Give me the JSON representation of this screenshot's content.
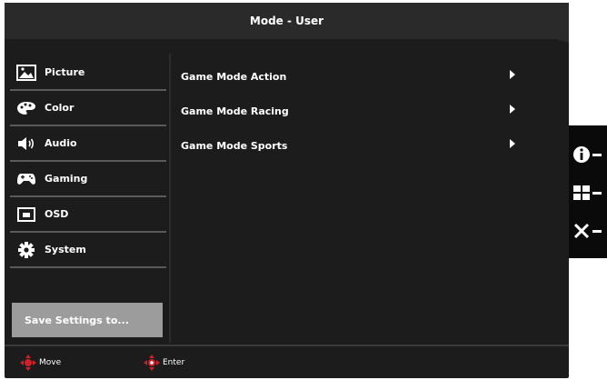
{
  "title": "Mode - User",
  "sidebar": {
    "items": [
      {
        "label": "Picture",
        "icon": "picture-icon"
      },
      {
        "label": "Color",
        "icon": "palette-icon"
      },
      {
        "label": "Audio",
        "icon": "speaker-icon"
      },
      {
        "label": "Gaming",
        "icon": "gamepad-icon"
      },
      {
        "label": "OSD",
        "icon": "osd-window-icon"
      },
      {
        "label": "System",
        "icon": "gear-icon"
      }
    ],
    "save_label": "Save Settings to..."
  },
  "options": [
    {
      "label": "Game Mode Action"
    },
    {
      "label": "Game Mode Racing"
    },
    {
      "label": "Game Mode Sports"
    }
  ],
  "footer": {
    "move_label": "Move",
    "enter_label": "Enter"
  },
  "hotkeys": [
    {
      "icon": "info-icon"
    },
    {
      "icon": "menu-grid-icon"
    },
    {
      "icon": "close-icon"
    }
  ],
  "colors": {
    "background": "#1c1c1c",
    "text": "#ffffff",
    "highlight": "#9c9c9c",
    "dpad_accent": "#d0202a"
  }
}
